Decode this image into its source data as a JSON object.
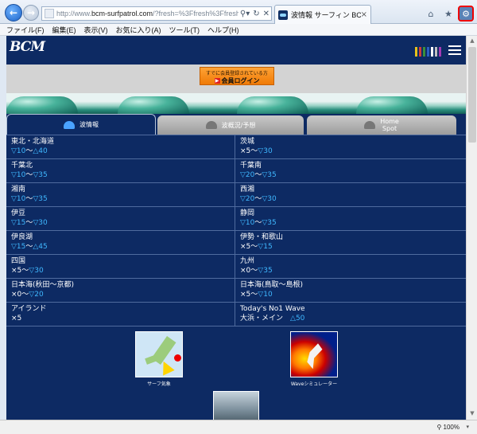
{
  "browser": {
    "url_prefix": "http://www.",
    "url_domain": "bcm-surfpatrol.com",
    "url_rest": "/?fresh=%3Ffresh%3Ffresh?fresh",
    "tab_title": "波情報 サーフィン BCM",
    "tab_close": "×",
    "search_glyph": "⚲▾",
    "refresh_glyph": "↻",
    "stop_glyph": "✕",
    "home_glyph": "⌂",
    "star_glyph": "★",
    "gear_glyph": "⚙"
  },
  "menu": [
    "ファイル(F)",
    "編集(E)",
    "表示(V)",
    "お気に入り(A)",
    "ツール(T)",
    "ヘルプ(H)"
  ],
  "site": {
    "logo": "BCM",
    "login_top": "すでに会員登録されている方",
    "login_main": "会員ログイン",
    "tabs": [
      {
        "label": "波情報"
      },
      {
        "label": "波概況/予想"
      },
      {
        "label_line1": "Home",
        "label_line2": "Spot"
      }
    ],
    "regions": [
      {
        "name": "東北・北海道",
        "c1": "▽10",
        "sep": "〜",
        "c2": "△40"
      },
      {
        "name": "茨城",
        "c1": "×5",
        "sep": "〜",
        "c2": "▽30"
      },
      {
        "name": "千葉北",
        "c1": "▽10",
        "sep": "〜",
        "c2": "▽35"
      },
      {
        "name": "千葉南",
        "c1": "▽20",
        "sep": "〜",
        "c2": "▽35"
      },
      {
        "name": "湘南",
        "c1": "▽10",
        "sep": "〜",
        "c2": "▽35"
      },
      {
        "name": "西湘",
        "c1": "▽20",
        "sep": "〜",
        "c2": "▽30"
      },
      {
        "name": "伊豆",
        "c1": "▽15",
        "sep": "〜",
        "c2": "▽30"
      },
      {
        "name": "静岡",
        "c1": "▽10",
        "sep": "〜",
        "c2": "▽35"
      },
      {
        "name": "伊良湖",
        "c1": "▽15",
        "sep": "〜",
        "c2": "△45"
      },
      {
        "name": "伊勢・和歌山",
        "c1": "×5",
        "sep": "〜",
        "c2": "▽15"
      },
      {
        "name": "四国",
        "c1": "×5",
        "sep": "〜",
        "c2": "▽30"
      },
      {
        "name": "九州",
        "c1": "×0",
        "sep": "〜",
        "c2": "▽35"
      },
      {
        "name": "日本海(秋田〜京都)",
        "c1": "×0",
        "sep": "〜",
        "c2": "▽20"
      },
      {
        "name": "日本海(鳥取〜島根)",
        "c1": "×5",
        "sep": "〜",
        "c2": "▽10"
      },
      {
        "name": "アイランド",
        "c1": "×5",
        "sep": "",
        "c2": ""
      },
      {
        "name": "Today's No1 Wave",
        "c1": "大浜・メイン",
        "sep": "　",
        "c2": "△50"
      }
    ],
    "thumb1_caption": "サーフ気象",
    "thumb2_caption": "Waveシミュレーター"
  },
  "status": {
    "zoom": "100%",
    "zoom_icon": "⚲",
    "caret": "▾"
  },
  "colors": {
    "brand_navy": "#0d2a63",
    "wave_blue": "#3fb8ff",
    "login_orange": "#f08a1c"
  }
}
